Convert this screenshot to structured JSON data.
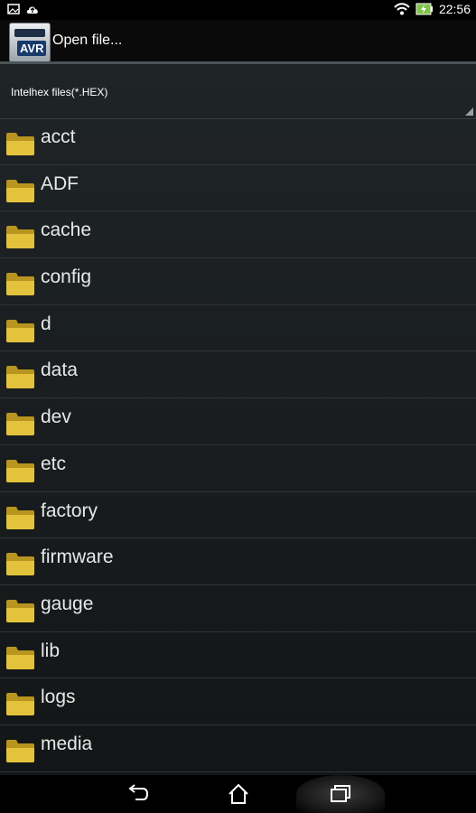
{
  "statusbar": {
    "time": "22:56",
    "icons": [
      "image-icon",
      "cloud-icon",
      "wifi-icon",
      "battery-charging-icon"
    ]
  },
  "actionbar": {
    "app_icon_text": "AVR",
    "title": "Open file..."
  },
  "filter": {
    "selected": "Intelhex files(*.HEX)"
  },
  "files": [
    {
      "name": "acct"
    },
    {
      "name": "ADF"
    },
    {
      "name": "cache"
    },
    {
      "name": "config"
    },
    {
      "name": "d"
    },
    {
      "name": "data"
    },
    {
      "name": "dev"
    },
    {
      "name": "etc"
    },
    {
      "name": "factory"
    },
    {
      "name": "firmware"
    },
    {
      "name": "gauge"
    },
    {
      "name": "lib"
    },
    {
      "name": "logs"
    },
    {
      "name": "media"
    }
  ],
  "navbar": {
    "icons": [
      "back-icon",
      "home-icon",
      "recent-apps-icon"
    ]
  },
  "colors": {
    "folder": "#e3c33c",
    "background": "#1a1e20",
    "divider": "#2f3437"
  }
}
